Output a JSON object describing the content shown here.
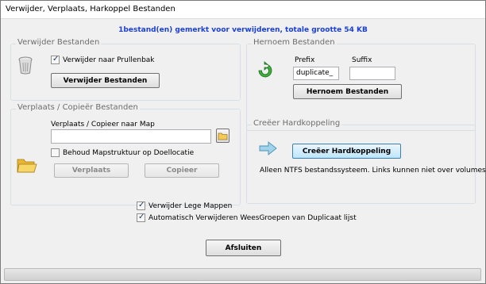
{
  "window": {
    "title": "Verwijder, Verplaats, Harkoppel Bestanden"
  },
  "status_message": "1bestand(en) gemerkt voor verwijderen, totale grootte 54 KB",
  "delete_group": {
    "label": "Verwijder Bestanden",
    "recycle_checkbox": {
      "label": "Verwijder naar Prullenbak",
      "checked": true
    },
    "delete_button": "Verwijder Bestanden"
  },
  "rename_group": {
    "label": "Hernoem Bestanden",
    "prefix_label": "Prefix",
    "suffix_label": "Suffix",
    "prefix_value": "duplicate_",
    "suffix_value": "",
    "rename_button": "Hernoem Bestanden"
  },
  "move_group": {
    "label": "Verplaats / Copieër Bestanden",
    "folder_label": "Verplaats / Copieer naar Map",
    "folder_value": "",
    "keep_structure_checkbox": {
      "label": "Behoud Mapstruktuur op Doellocatie",
      "checked": false
    },
    "move_button": "Verplaats",
    "copy_button": "Copieer"
  },
  "hardlink_group": {
    "label": "Creëer Hardkoppeling",
    "create_button": "Creëer Hardkoppeling",
    "note": "Alleen NTFS bestandssysteem.  Links kunnen niet over volumes"
  },
  "options": {
    "remove_empty_folders": {
      "label": "Verwijder Lege Mappen",
      "checked": true
    },
    "auto_remove_groups": {
      "label": "Automatisch Verwijderen WeesGroepen van Duplicaat lijst",
      "checked": true
    }
  },
  "close_button": "Afsluiten",
  "icons": {
    "recycle_bin": "recycle-bin-icon",
    "rename": "rename-arrow-icon",
    "folder": "folder-icon",
    "browse": "browse-folder-icon",
    "hardlink": "arrow-right-icon"
  },
  "colors": {
    "status_text": "#1a3fd6",
    "group_label": "#6d6d6d",
    "focus_button": "#bee6fd"
  }
}
